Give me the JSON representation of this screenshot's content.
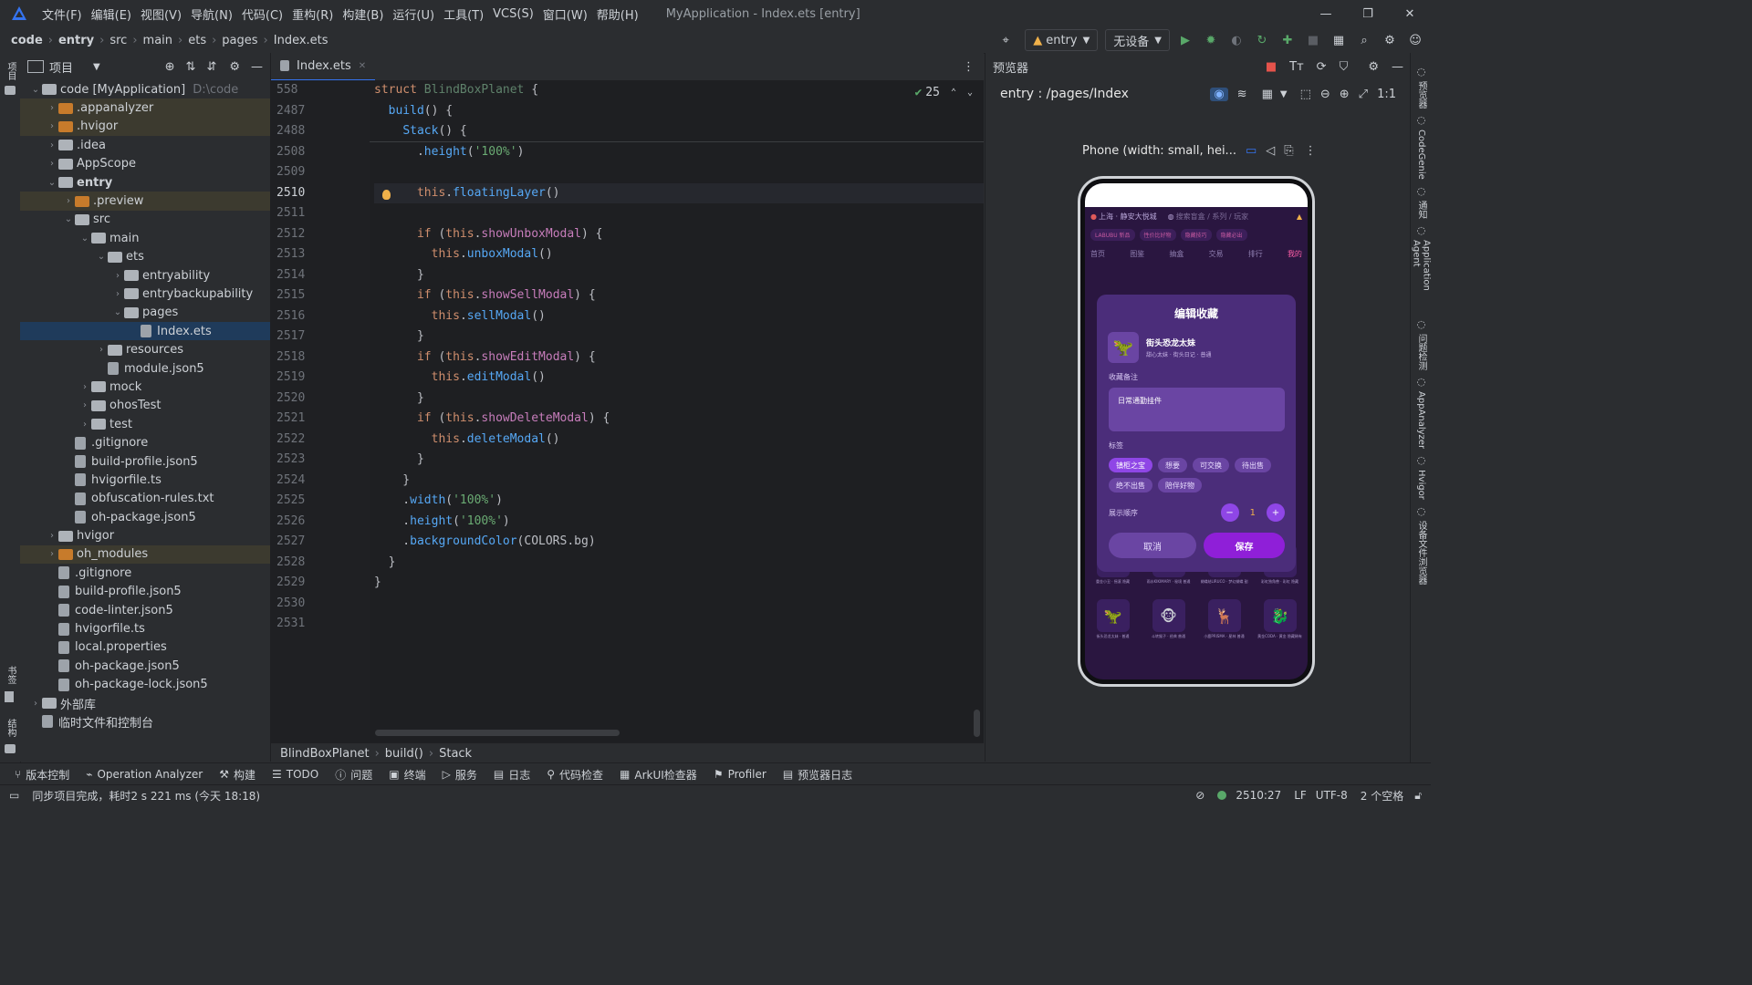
{
  "app": {
    "menu": [
      "文件(F)",
      "编辑(E)",
      "视图(V)",
      "导航(N)",
      "代码(C)",
      "重构(R)",
      "构建(B)",
      "运行(U)",
      "工具(T)",
      "VCS(S)",
      "窗口(W)",
      "帮助(H)"
    ],
    "window_title": "MyApplication - Index.ets [entry]"
  },
  "nav": {
    "breadcrumbs": [
      "code",
      "entry",
      "src",
      "main",
      "ets",
      "pages",
      "Index.ets"
    ],
    "run_config": "entry",
    "device": "无设备"
  },
  "project_panel": {
    "title": "项目",
    "tree": [
      {
        "label": "code [MyApplication]",
        "suffix": "D:\\code",
        "level": 0,
        "chev": "down",
        "kind": "folder"
      },
      {
        "label": ".appanalyzer",
        "level": 1,
        "chev": "right",
        "kind": "folder-orange",
        "hl": true
      },
      {
        "label": ".hvigor",
        "level": 1,
        "chev": "right",
        "kind": "folder-orange",
        "hl": true
      },
      {
        "label": ".idea",
        "level": 1,
        "chev": "right",
        "kind": "folder"
      },
      {
        "label": "AppScope",
        "level": 1,
        "chev": "right",
        "kind": "folder"
      },
      {
        "label": "entry",
        "level": 1,
        "chev": "down",
        "kind": "folder",
        "bold": true
      },
      {
        "label": ".preview",
        "level": 2,
        "chev": "right",
        "kind": "folder-orange",
        "hl": true
      },
      {
        "label": "src",
        "level": 2,
        "chev": "down",
        "kind": "folder"
      },
      {
        "label": "main",
        "level": 3,
        "chev": "down",
        "kind": "folder"
      },
      {
        "label": "ets",
        "level": 4,
        "chev": "down",
        "kind": "folder"
      },
      {
        "label": "entryability",
        "level": 5,
        "chev": "right",
        "kind": "folder"
      },
      {
        "label": "entrybackupability",
        "level": 5,
        "chev": "right",
        "kind": "folder"
      },
      {
        "label": "pages",
        "level": 5,
        "chev": "down",
        "kind": "folder"
      },
      {
        "label": "Index.ets",
        "level": 6,
        "chev": "",
        "kind": "file",
        "sel": true
      },
      {
        "label": "resources",
        "level": 4,
        "chev": "right",
        "kind": "folder"
      },
      {
        "label": "module.json5",
        "level": 4,
        "chev": "",
        "kind": "file"
      },
      {
        "label": "mock",
        "level": 3,
        "chev": "right",
        "kind": "folder"
      },
      {
        "label": "ohosTest",
        "level": 3,
        "chev": "right",
        "kind": "folder"
      },
      {
        "label": "test",
        "level": 3,
        "chev": "right",
        "kind": "folder"
      },
      {
        "label": ".gitignore",
        "level": 2,
        "chev": "",
        "kind": "file"
      },
      {
        "label": "build-profile.json5",
        "level": 2,
        "chev": "",
        "kind": "file"
      },
      {
        "label": "hvigorfile.ts",
        "level": 2,
        "chev": "",
        "kind": "file"
      },
      {
        "label": "obfuscation-rules.txt",
        "level": 2,
        "chev": "",
        "kind": "file"
      },
      {
        "label": "oh-package.json5",
        "level": 2,
        "chev": "",
        "kind": "file"
      },
      {
        "label": "hvigor",
        "level": 1,
        "chev": "right",
        "kind": "folder"
      },
      {
        "label": "oh_modules",
        "level": 1,
        "chev": "right",
        "kind": "folder-orange",
        "hl": true
      },
      {
        "label": ".gitignore",
        "level": 1,
        "chev": "",
        "kind": "file"
      },
      {
        "label": "build-profile.json5",
        "level": 1,
        "chev": "",
        "kind": "file"
      },
      {
        "label": "code-linter.json5",
        "level": 1,
        "chev": "",
        "kind": "file"
      },
      {
        "label": "hvigorfile.ts",
        "level": 1,
        "chev": "",
        "kind": "file"
      },
      {
        "label": "local.properties",
        "level": 1,
        "chev": "",
        "kind": "file"
      },
      {
        "label": "oh-package.json5",
        "level": 1,
        "chev": "",
        "kind": "file"
      },
      {
        "label": "oh-package-lock.json5",
        "level": 1,
        "chev": "",
        "kind": "file"
      },
      {
        "label": "外部库",
        "level": 0,
        "chev": "right",
        "kind": "lib"
      },
      {
        "label": "临时文件和控制台",
        "level": 0,
        "chev": "",
        "kind": "scratch"
      }
    ]
  },
  "editor": {
    "tab": "Index.ets",
    "inspection_count": "25",
    "lines": [
      {
        "n": "558",
        "parts": [
          [
            "kw",
            "struct "
          ],
          [
            "type",
            "BlindBoxPlanet "
          ],
          [
            "txt",
            "{"
          ]
        ]
      },
      {
        "n": "2487",
        "parts": [
          [
            "txt",
            "  "
          ],
          [
            "fn",
            "build"
          ],
          [
            "txt",
            "() {"
          ]
        ]
      },
      {
        "n": "2488",
        "parts": [
          [
            "txt",
            "    "
          ],
          [
            "fn",
            "Stack"
          ],
          [
            "txt",
            "() {"
          ]
        ]
      },
      {
        "n": "2508",
        "parts": [
          [
            "txt",
            "      ."
          ],
          [
            "fn",
            "height"
          ],
          [
            "txt",
            "("
          ],
          [
            "str",
            "'100%'"
          ],
          [
            "txt",
            ")"
          ]
        ]
      },
      {
        "n": "2509",
        "parts": [
          [
            "txt",
            ""
          ]
        ]
      },
      {
        "n": "2510",
        "parts": [
          [
            "txt",
            "      "
          ],
          [
            "kw",
            "this"
          ],
          [
            "txt",
            "."
          ],
          [
            "fn",
            "floatingLayer"
          ],
          [
            "txt",
            "()"
          ]
        ],
        "active": true
      },
      {
        "n": "2511",
        "parts": [
          [
            "txt",
            ""
          ]
        ]
      },
      {
        "n": "2512",
        "parts": [
          [
            "txt",
            "      "
          ],
          [
            "kw",
            "if "
          ],
          [
            "txt",
            "("
          ],
          [
            "kw",
            "this"
          ],
          [
            "txt",
            "."
          ],
          [
            "prop",
            "showUnboxModal"
          ],
          [
            "txt",
            ") {"
          ]
        ]
      },
      {
        "n": "2513",
        "parts": [
          [
            "txt",
            "        "
          ],
          [
            "kw",
            "this"
          ],
          [
            "txt",
            "."
          ],
          [
            "fn",
            "unboxModal"
          ],
          [
            "txt",
            "()"
          ]
        ]
      },
      {
        "n": "2514",
        "parts": [
          [
            "txt",
            "      }"
          ]
        ]
      },
      {
        "n": "2515",
        "parts": [
          [
            "txt",
            "      "
          ],
          [
            "kw",
            "if "
          ],
          [
            "txt",
            "("
          ],
          [
            "kw",
            "this"
          ],
          [
            "txt",
            "."
          ],
          [
            "prop",
            "showSellModal"
          ],
          [
            "txt",
            ") {"
          ]
        ]
      },
      {
        "n": "2516",
        "parts": [
          [
            "txt",
            "        "
          ],
          [
            "kw",
            "this"
          ],
          [
            "txt",
            "."
          ],
          [
            "fn",
            "sellModal"
          ],
          [
            "txt",
            "()"
          ]
        ]
      },
      {
        "n": "2517",
        "parts": [
          [
            "txt",
            "      }"
          ]
        ]
      },
      {
        "n": "2518",
        "parts": [
          [
            "txt",
            "      "
          ],
          [
            "kw",
            "if "
          ],
          [
            "txt",
            "("
          ],
          [
            "kw",
            "this"
          ],
          [
            "txt",
            "."
          ],
          [
            "prop",
            "showEditModal"
          ],
          [
            "txt",
            ") {"
          ]
        ]
      },
      {
        "n": "2519",
        "parts": [
          [
            "txt",
            "        "
          ],
          [
            "kw",
            "this"
          ],
          [
            "txt",
            "."
          ],
          [
            "fn",
            "editModal"
          ],
          [
            "txt",
            "()"
          ]
        ]
      },
      {
        "n": "2520",
        "parts": [
          [
            "txt",
            "      }"
          ]
        ]
      },
      {
        "n": "2521",
        "parts": [
          [
            "txt",
            "      "
          ],
          [
            "kw",
            "if "
          ],
          [
            "txt",
            "("
          ],
          [
            "kw",
            "this"
          ],
          [
            "txt",
            "."
          ],
          [
            "prop",
            "showDeleteModal"
          ],
          [
            "txt",
            ") {"
          ]
        ]
      },
      {
        "n": "2522",
        "parts": [
          [
            "txt",
            "        "
          ],
          [
            "kw",
            "this"
          ],
          [
            "txt",
            "."
          ],
          [
            "fn",
            "deleteModal"
          ],
          [
            "txt",
            "()"
          ]
        ]
      },
      {
        "n": "2523",
        "parts": [
          [
            "txt",
            "      }"
          ]
        ]
      },
      {
        "n": "2524",
        "parts": [
          [
            "txt",
            "    }"
          ]
        ]
      },
      {
        "n": "2525",
        "parts": [
          [
            "txt",
            "    ."
          ],
          [
            "fn",
            "width"
          ],
          [
            "txt",
            "("
          ],
          [
            "str",
            "'100%'"
          ],
          [
            "txt",
            ")"
          ]
        ]
      },
      {
        "n": "2526",
        "parts": [
          [
            "txt",
            "    ."
          ],
          [
            "fn",
            "height"
          ],
          [
            "txt",
            "("
          ],
          [
            "str",
            "'100%'"
          ],
          [
            "txt",
            ")"
          ]
        ]
      },
      {
        "n": "2527",
        "parts": [
          [
            "txt",
            "    ."
          ],
          [
            "fn",
            "backgroundColor"
          ],
          [
            "txt",
            "(COLORS.bg)"
          ]
        ]
      },
      {
        "n": "2528",
        "parts": [
          [
            "txt",
            "  }"
          ]
        ]
      },
      {
        "n": "2529",
        "parts": [
          [
            "txt",
            "}"
          ]
        ]
      },
      {
        "n": "2530",
        "parts": [
          [
            "txt",
            ""
          ]
        ]
      },
      {
        "n": "2531",
        "parts": [
          [
            "txt",
            ""
          ]
        ]
      }
    ],
    "breadcrumbs": [
      "BlindBoxPlanet",
      "build()",
      "Stack"
    ]
  },
  "preview": {
    "title": "预览器",
    "route": "entry : /pages/Index",
    "device_label": "Phone (width: small, hei...",
    "phone": {
      "location": "上海 · 静安大悦城",
      "search_placeholder": "搜索盲盒 / 系列 / 玩家",
      "tags_top": [
        "LABUBU 新品",
        "性价比好物",
        "隐藏技巧",
        "隐藏必出"
      ],
      "tabs": [
        "首页",
        "图鉴",
        "抽盒",
        "交易",
        "排行",
        "我的"
      ],
      "modal": {
        "title": "编辑收藏",
        "item_name": "街头恐龙太妹",
        "item_sub": "甜心太妹 · 街头日记 · 普通",
        "note_label": "收藏备注",
        "note_value": "日常通勤挂件",
        "tags_label": "标签",
        "tags": [
          "镇柜之宝",
          "想要",
          "可交换",
          "待出售",
          "绝不出售",
          "陪伴好物"
        ],
        "order_label": "展示顺序",
        "order_value": "1",
        "cancel": "取消",
        "save": "保存"
      },
      "grid_row1": [
        "重金小丑 · 摇滚 隐藏",
        "雨水KIKIMARY · 秘境 普通",
        "蝴蝶结LIRUCO · 梦幻蝴蝶 甜心",
        "彩虹独角兽 · 彩虹 隐藏"
      ],
      "grid_row2": [
        "街头恐龙太妹 · 普通",
        "斗转猴子 · 经典 普通",
        "小鹿PRISMA · 星林 普通",
        "黄金CODA · 黄金 隐藏稀有"
      ]
    }
  },
  "left_rail": {
    "top": "项目",
    "bottom1": "书签",
    "bottom2": "结构"
  },
  "right_rail": [
    "预览器",
    "CodeGenie",
    "通知",
    "Application Agent",
    "问题检测",
    "AppAnalyzer",
    "Hvigor",
    "设备文件浏览器"
  ],
  "bottom_tools": [
    "版本控制",
    "Operation Analyzer",
    "构建",
    "TODO",
    "问题",
    "终端",
    "服务",
    "日志",
    "代码检查",
    "ArkUI检查器",
    "Profiler",
    "预览器日志"
  ],
  "status": {
    "message": "同步项目完成，耗时2 s 221 ms (今天 18:18)",
    "position": "2510:27",
    "line_sep": "LF",
    "encoding": "UTF-8",
    "indent": "2 个空格"
  },
  "colors": {
    "accent": "#3574f0",
    "purple": "#8f46e6",
    "green": "#59a869"
  }
}
